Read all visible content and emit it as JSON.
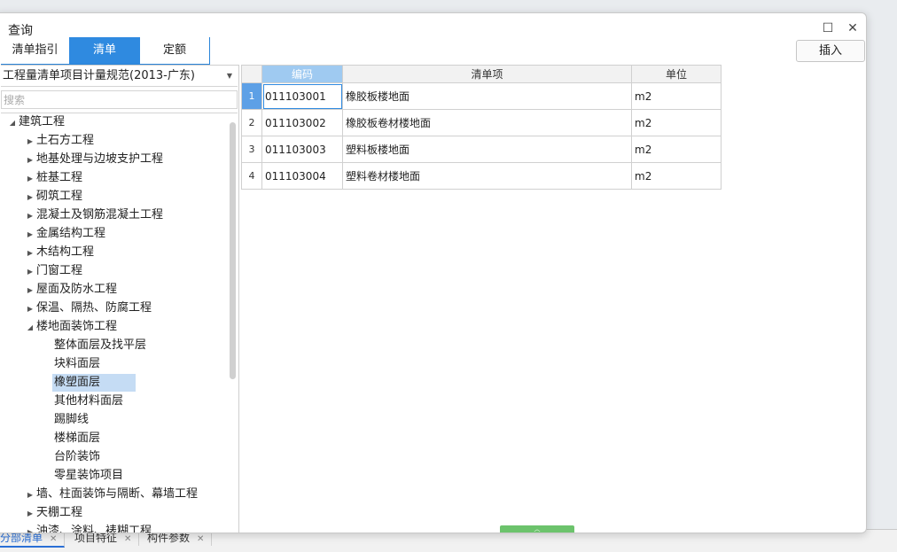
{
  "window": {
    "title": "查询"
  },
  "tabs": [
    "清单指引",
    "清单",
    "定额"
  ],
  "insert_label": "插入",
  "library": {
    "selected": "工程量清单项目计量规范(2013-广东)"
  },
  "search": {
    "placeholder": "搜索"
  },
  "tree": [
    "建筑工程",
    "土石方工程",
    "地基处理与边坡支护工程",
    "桩基工程",
    "砌筑工程",
    "混凝土及钢筋混凝土工程",
    "金属结构工程",
    "木结构工程",
    "门窗工程",
    "屋面及防水工程",
    "保温、隔热、防腐工程",
    "楼地面装饰工程",
    "整体面层及找平层",
    "块料面层",
    "橡塑面层",
    "其他材料面层",
    "踢脚线",
    "楼梯面层",
    "台阶装饰",
    "零星装饰项目",
    "墙、柱面装饰与隔断、幕墙工程",
    "天棚工程",
    "油漆、涂料、裱糊工程"
  ],
  "table": {
    "columns": [
      "编码",
      "清单项",
      "单位"
    ],
    "rows": [
      {
        "n": "1",
        "code": "011103001",
        "name": "橡胶板楼地面",
        "unit": "m2"
      },
      {
        "n": "2",
        "code": "011103002",
        "name": "橡胶板卷材楼地面",
        "unit": "m2"
      },
      {
        "n": "3",
        "code": "011103003",
        "name": "塑料板楼地面",
        "unit": "m2"
      },
      {
        "n": "4",
        "code": "011103004",
        "name": "塑料卷材楼地面",
        "unit": "m2"
      }
    ]
  },
  "bottom_tabs": [
    "分部清单",
    "项目特征",
    "构件参数"
  ]
}
